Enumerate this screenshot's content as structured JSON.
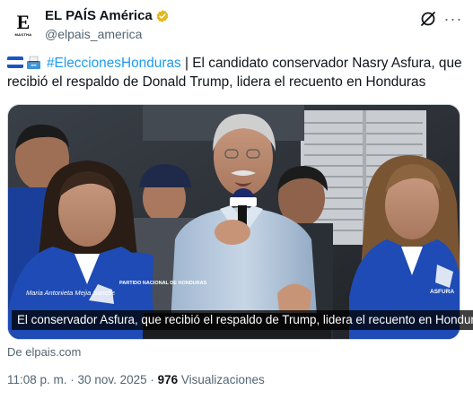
{
  "account": {
    "logo_letter": "E",
    "logo_subtext": "MASTHA",
    "display_name": "EL PAÍS América",
    "handle": "@elpais_america"
  },
  "icons": {
    "verified": "verified-badge-icon",
    "grok": "grok-icon",
    "more": "more-options-icon",
    "flag": "honduras-flag-icon",
    "ballot": "ballot-box-icon"
  },
  "tweet": {
    "hashtag": "#EleccionesHonduras",
    "text": " | El candidato conservador Nasry Asfura, que recibió el respaldo de Donald Trump, lidera el recuento en Honduras"
  },
  "media": {
    "caption": "El conservador Asfura, que recibió el respaldo de Trump, lidera el recuento en Honduras",
    "badge_left": "Maria Antonieta Mejia Sanchez",
    "badge_center": "PARTIDO NACIONAL DE HONDURAS",
    "badge_right": "ASFURA"
  },
  "source": "De elpais.com",
  "meta": {
    "time": "11:08 p. m.",
    "separator": " · ",
    "date": "30 nov. 2025",
    "views_count": "976",
    "views_label": " Visualizaciones"
  },
  "colors": {
    "text": "#0f1419",
    "secondary": "#536471",
    "link": "#1d9bf0",
    "verified_gold": "#e2b719",
    "jacket_blue": "#1e4bb5"
  }
}
